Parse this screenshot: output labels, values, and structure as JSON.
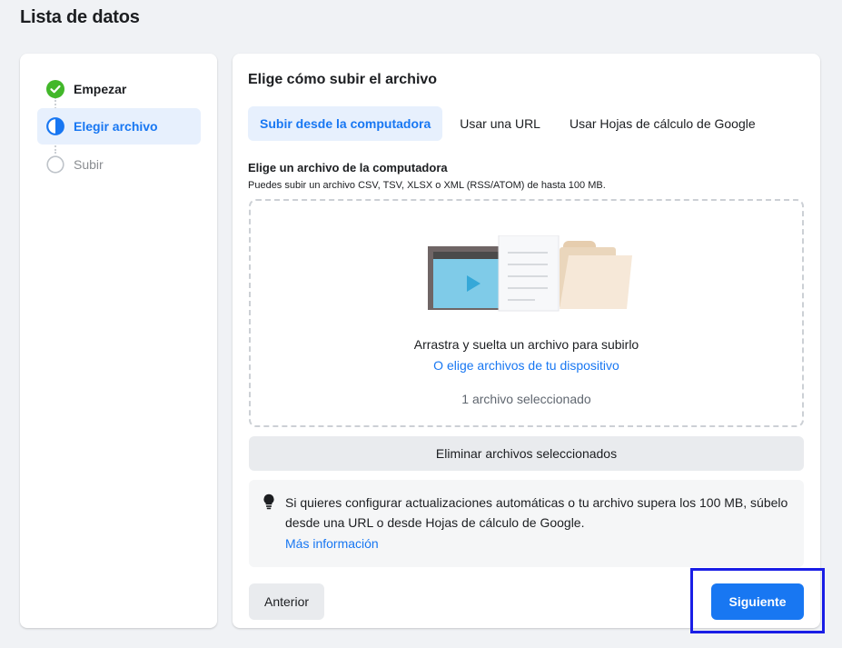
{
  "page": {
    "title": "Lista de datos"
  },
  "steps": [
    {
      "label": "Empezar",
      "state": "completed",
      "icon": "check-circle-icon"
    },
    {
      "label": "Elegir archivo",
      "state": "current",
      "icon": "half-circle-icon"
    },
    {
      "label": "Subir",
      "state": "pending",
      "icon": "empty-circle-icon"
    }
  ],
  "main": {
    "title": "Elige cómo subir el archivo",
    "tabs": [
      {
        "label": "Subir desde la computadora",
        "active": true
      },
      {
        "label": "Usar una URL",
        "active": false
      },
      {
        "label": "Usar Hojas de cálculo de Google",
        "active": false
      }
    ],
    "section_title": "Elige un archivo de la computadora",
    "section_subtitle": "Puedes subir un archivo CSV, TSV, XLSX o XML (RSS/ATOM) de hasta 100 MB.",
    "dropzone": {
      "instruction": "Arrastra y suelta un archivo para subirlo",
      "link_prefix": "O ",
      "link_label": "elige archivos de tu dispositivo",
      "selected_text": "1 archivo seleccionado",
      "illustration": "files-upload-illustration"
    },
    "remove_label": "Eliminar archivos seleccionados",
    "info": {
      "icon": "lightbulb-icon",
      "text": "Si quieres configurar actualizaciones automáticas o tu archivo supera los 100 MB, súbelo desde una URL o desde Hojas de cálculo de Google.",
      "link_label": "Más información"
    },
    "prev_label": "Anterior",
    "next_label": "Siguiente"
  },
  "colors": {
    "accent": "#1877f2",
    "success": "#42b72a",
    "active_bg": "#e7f0fd",
    "highlight": "#1a1ee6"
  }
}
